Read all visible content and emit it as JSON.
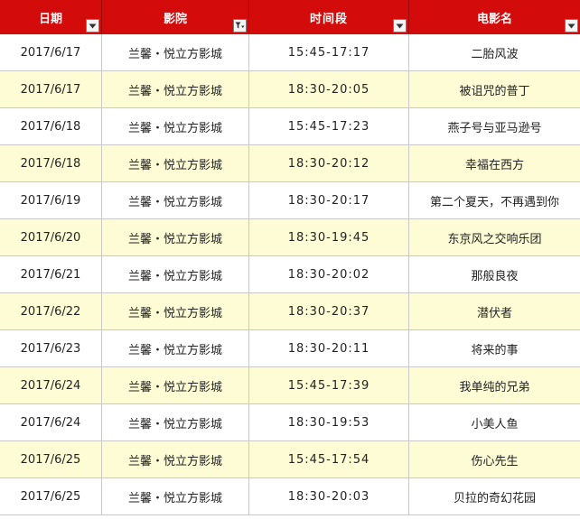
{
  "table": {
    "headers": [
      {
        "label": "日期",
        "filter_icon": "dropdown-arrow-icon"
      },
      {
        "label": "影院",
        "filter_icon": "filter-funnel-icon"
      },
      {
        "label": "时间段",
        "filter_icon": "dropdown-arrow-icon"
      },
      {
        "label": "电影名",
        "filter_icon": "dropdown-arrow-icon"
      }
    ],
    "rows": [
      [
        "2017/6/17",
        "兰馨・悦立方影城",
        "15:45-17:17",
        "二胎风波"
      ],
      [
        "2017/6/17",
        "兰馨・悦立方影城",
        "18:30-20:05",
        "被诅咒的普丁"
      ],
      [
        "2017/6/18",
        "兰馨・悦立方影城",
        "15:45-17:23",
        "燕子号与亚马逊号"
      ],
      [
        "2017/6/18",
        "兰馨・悦立方影城",
        "18:30-20:12",
        "幸福在西方"
      ],
      [
        "2017/6/19",
        "兰馨・悦立方影城",
        "18:30-20:17",
        "第二个夏天，不再遇到你"
      ],
      [
        "2017/6/20",
        "兰馨・悦立方影城",
        "18:30-19:45",
        "东京风之交响乐团"
      ],
      [
        "2017/6/21",
        "兰馨・悦立方影城",
        "18:30-20:02",
        "那般良夜"
      ],
      [
        "2017/6/22",
        "兰馨・悦立方影城",
        "18:30-20:37",
        "潜伏者"
      ],
      [
        "2017/6/23",
        "兰馨・悦立方影城",
        "18:30-20:11",
        "将来的事"
      ],
      [
        "2017/6/24",
        "兰馨・悦立方影城",
        "15:45-17:39",
        "我单纯的兄弟"
      ],
      [
        "2017/6/24",
        "兰馨・悦立方影城",
        "18:30-19:53",
        "小美人鱼"
      ],
      [
        "2017/6/25",
        "兰馨・悦立方影城",
        "15:45-17:54",
        "伤心先生"
      ],
      [
        "2017/6/25",
        "兰馨・悦立方影城",
        "18:30-20:03",
        "贝拉的奇幻花园"
      ]
    ]
  },
  "colors": {
    "header_bg": "#d40b0b",
    "header_text": "#ffffff",
    "band_row": "#fefcd4",
    "plain_row": "#ffffff"
  }
}
